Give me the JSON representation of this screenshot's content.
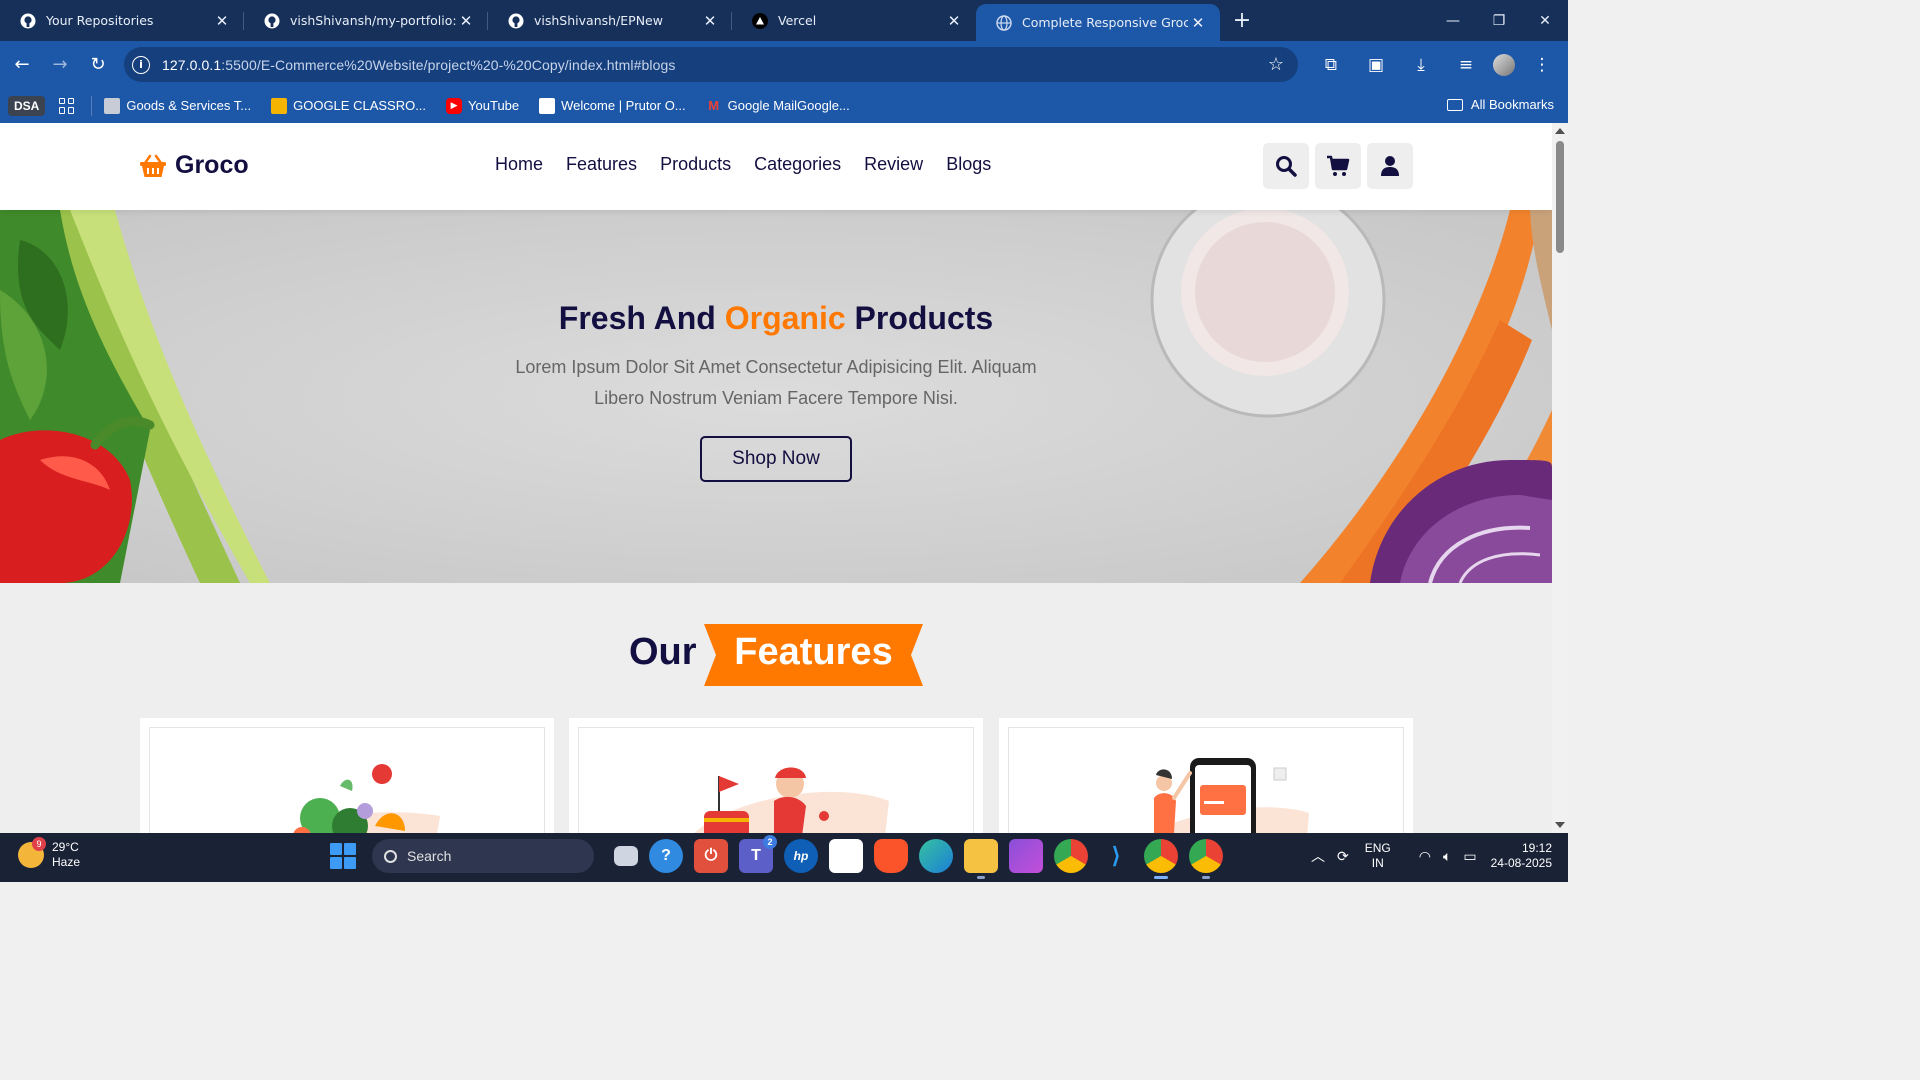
{
  "browser": {
    "tabs": [
      {
        "title": "Your Repositories",
        "icon": "github-icon",
        "active": false
      },
      {
        "title": "vishShivansh/my-portfolio: A m",
        "icon": "github-icon",
        "active": false
      },
      {
        "title": "vishShivansh/EPNew",
        "icon": "github-icon",
        "active": false
      },
      {
        "title": "Vercel",
        "icon": "vercel-icon",
        "active": false
      },
      {
        "title": "Complete Responsive Grocery W",
        "icon": "globe-icon",
        "active": true
      }
    ],
    "url_host": "127.0.0.1",
    "url_rest": ":5500/E-Commerce%20Website/project%20-%20Copy/index.html#blogs",
    "bookmarks": [
      {
        "label": "Goods & Services T...",
        "icon": "gst-icon"
      },
      {
        "label": "GOOGLE CLASSRO...",
        "icon": "classroom-icon"
      },
      {
        "label": "YouTube",
        "icon": "youtube-icon"
      },
      {
        "label": "Welcome | Prutor O...",
        "icon": "prutor-icon"
      },
      {
        "label": "Google MailGoogle...",
        "icon": "gmail-icon"
      }
    ],
    "bookmark_chip": "DSA",
    "all_bookmarks": "All Bookmarks"
  },
  "site": {
    "logo": "Groco",
    "nav": [
      "Home",
      "Features",
      "Products",
      "Categories",
      "Review",
      "Blogs"
    ],
    "hero": {
      "title_pre": "Fresh And",
      "title_accent": "Organic",
      "title_post": "Products",
      "text": "Lorem Ipsum Dolor Sit Amet Consectetur Adipisicing Elit. Aliquam Libero Nostrum Veniam Facere Tempore Nisi.",
      "button": "Shop Now"
    },
    "features_heading_plain": "Our",
    "features_heading_accent": "Features"
  },
  "taskbar": {
    "weather_temp": "29°C",
    "weather_desc": "Haze",
    "weather_badge": "9",
    "search": "Search",
    "teams_badge": "2",
    "lang_line1": "ENG",
    "lang_line2": "IN",
    "time": "19:12",
    "date": "24-08-2025"
  },
  "colors": {
    "accent": "#ff7800",
    "text_dark": "#130f40",
    "chrome_dark": "#16305a",
    "chrome_blue": "#1d57a8"
  }
}
